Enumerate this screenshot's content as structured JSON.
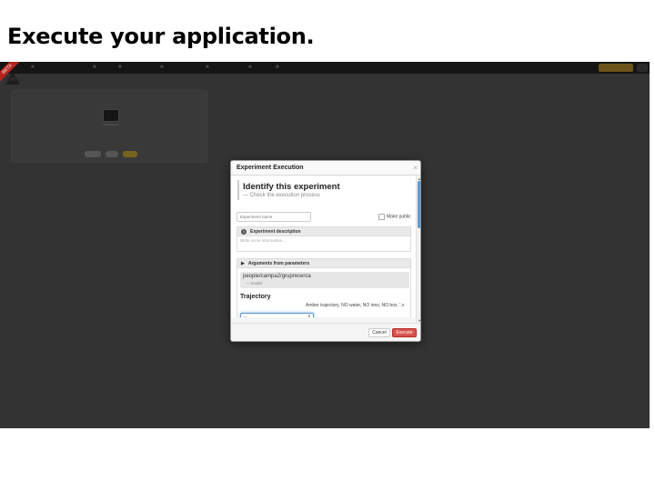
{
  "slide": {
    "title": "Execute your application."
  },
  "screen": {
    "beta_label": "BETA",
    "topbar": {
      "nav_items": [
        "",
        "",
        "",
        "",
        "",
        "",
        ""
      ],
      "user_button": "",
      "expand_button": ""
    },
    "app_panel": {
      "app_name": "",
      "description": "",
      "badges": [
        "",
        "",
        ""
      ]
    }
  },
  "modal": {
    "title": "Experiment Execution",
    "close": "×",
    "heading": "Identify this experiment",
    "subheading": "— Check the execution process",
    "experiment_name_placeholder": "Experiment name",
    "make_public_label": "Make public",
    "description_section": "Experiment description",
    "description_placeholder": "Write some information...",
    "arguments_section": "Arguments from parameters",
    "path": "people/campa2/gruprecerca",
    "path_sub": "— model",
    "trajectory_label": "Trajectory",
    "trajectory_value": "Amber trajectory. NO water, NO ions, NO box. '.x",
    "trajectory_select_value": "--",
    "cancel_label": "Cancel",
    "execute_label": "Execute"
  },
  "colors": {
    "execute_button": "#d9534f",
    "scroll_thumb": "#5b9bd5",
    "user_button": "#6a5418",
    "beta_ribbon": "#b3261e"
  }
}
